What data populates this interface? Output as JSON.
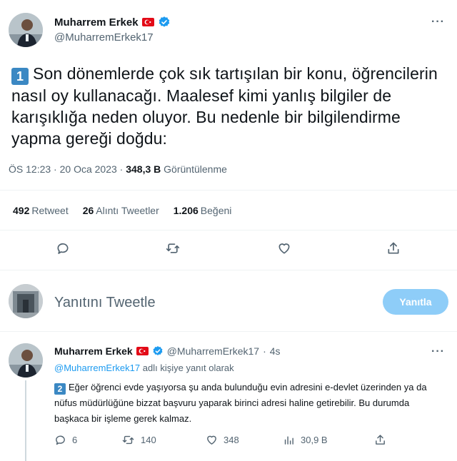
{
  "main_tweet": {
    "display_name": "Muharrem Erkek",
    "handle": "@MuharremErkek17",
    "number_badge": "1",
    "text": "Son dönemlerde çok sık tartışılan bir konu, öğrencilerin nasıl oy kullanacağı. Maalesef kimi yanlış bilgiler de karışıklığa neden oluyor. Bu nedenle bir bilgilendirme yapma gereği doğdu:",
    "time": "ÖS 12:23",
    "date": "20 Oca 2023",
    "views_count": "348,3 B",
    "views_label": "Görüntülenme",
    "separator": "·"
  },
  "stats": {
    "retweets_count": "492",
    "retweets_label": "Retweet",
    "quotes_count": "26",
    "quotes_label": "Alıntı Tweetler",
    "likes_count": "1.206",
    "likes_label": "Beğeni"
  },
  "composer": {
    "placeholder": "Yanıtını Tweetle",
    "button_label": "Yanıtla"
  },
  "reply_tweet": {
    "display_name": "Muharrem Erkek",
    "handle": "@MuharremErkek17",
    "time": "4s",
    "separator": "·",
    "reply_to_handle": "@MuharremErkek17",
    "reply_to_suffix": "adlı kişiye yanıt olarak",
    "number_badge": "2",
    "text": "Eğer öğrenci evde yaşıyorsa şu anda bulunduğu evin adresini e-devlet üzerinden ya da nüfus müdürlüğüne bizzat başvuru yaparak birinci adresi haline getirebilir. Bu durumda başkaca bir işleme gerek kalmaz.",
    "replies": "6",
    "retweets": "140",
    "likes": "348",
    "views": "30,9 B"
  },
  "icons": {
    "more": "more-icon",
    "reply": "reply-icon",
    "retweet": "retweet-icon",
    "like": "heart-icon",
    "share": "share-icon",
    "views": "views-icon",
    "verified": "verified-icon",
    "flag": "turkey-flag-icon"
  },
  "colors": {
    "accent": "#1d9bf0",
    "reply_button": "#8ecdf8",
    "secondary_text": "#536471",
    "number_badge": "#3b88c3"
  }
}
